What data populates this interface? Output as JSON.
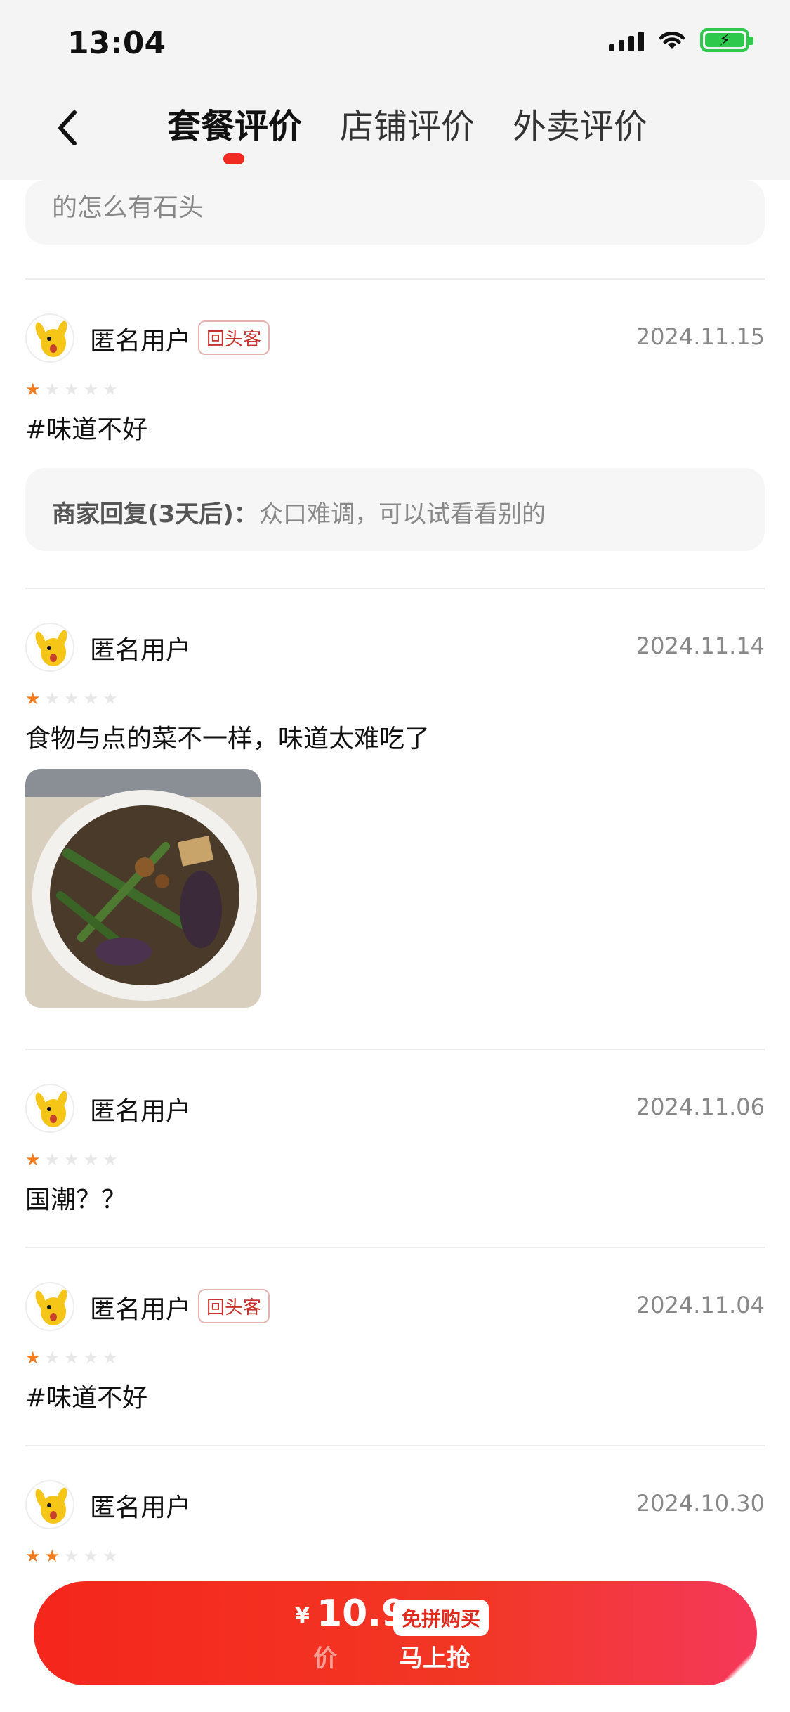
{
  "status_bar": {
    "time": "13:04"
  },
  "header": {
    "tabs": [
      {
        "label": "套餐评价",
        "active": true
      },
      {
        "label": "店铺评价",
        "active": false
      },
      {
        "label": "外卖评价",
        "active": false
      }
    ]
  },
  "truncated_reply": {
    "text": "的怎么有石头"
  },
  "reviews": [
    {
      "user": "匿名用户",
      "badge": "回头客",
      "date": "2024.11.15",
      "stars": 1,
      "text": "#味道不好",
      "reply_label": "商家回复(3天后)：",
      "reply_text": "众口难调，可以试看看别的"
    },
    {
      "user": "匿名用户",
      "date": "2024.11.14",
      "stars": 1,
      "text": "食物与点的菜不一样，味道太难吃了",
      "has_photo": true
    },
    {
      "user": "匿名用户",
      "date": "2024.11.06",
      "stars": 1,
      "text": "国潮？？"
    },
    {
      "user": "匿名用户",
      "badge": "回头客",
      "date": "2024.11.04",
      "stars": 1,
      "text": "#味道不好"
    },
    {
      "user": "匿名用户",
      "date": "2024.10.30",
      "stars": 2
    }
  ],
  "cta": {
    "currency": "¥",
    "price": "10.9",
    "tag": "免拼购买",
    "sub_label_faded": "价",
    "action": "马上抢"
  },
  "colors": {
    "accent": "#f02a20",
    "star_on": "#f37b1d",
    "badge_text": "#c5332c"
  }
}
